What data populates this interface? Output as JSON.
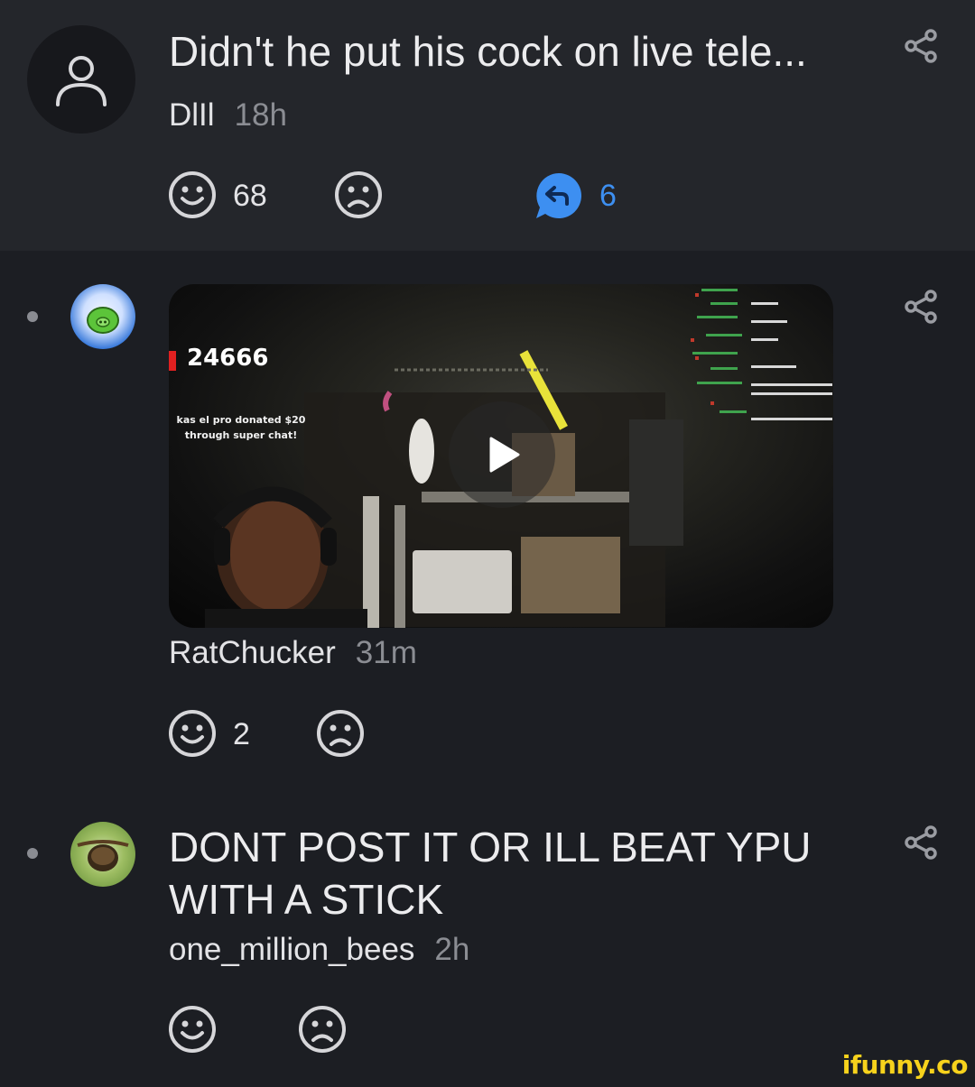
{
  "comments": [
    {
      "text": "Didn't he put his cock on live tele...",
      "user": "DlIl",
      "time": "18h",
      "like_count": "68",
      "reply_count": "6",
      "avatar": "default-user-icon"
    },
    {
      "user": "RatChucker",
      "time": "31m",
      "like_count": "2",
      "avatar": "green-pig-avatar",
      "media": {
        "type": "video",
        "overlay_count": "24666",
        "overlay_donation": "kas el pro donated $20 through super chat!"
      }
    },
    {
      "text_line1": "DONT POST IT OR ILL BEAT YPU",
      "text_line2": "WITH A STICK",
      "user": "one_million_bees",
      "time": "2h",
      "avatar": "beehive-avatar"
    }
  ],
  "watermark": "ifunny.co",
  "colors": {
    "background": "#1c1e23",
    "highlight_bg": "#24262b",
    "reply_accent": "#3d8ff1",
    "timestamp": "#8b8d93"
  },
  "icons": [
    "share-icon",
    "smile-icon",
    "frown-icon",
    "reply-bubble-icon",
    "play-icon"
  ]
}
